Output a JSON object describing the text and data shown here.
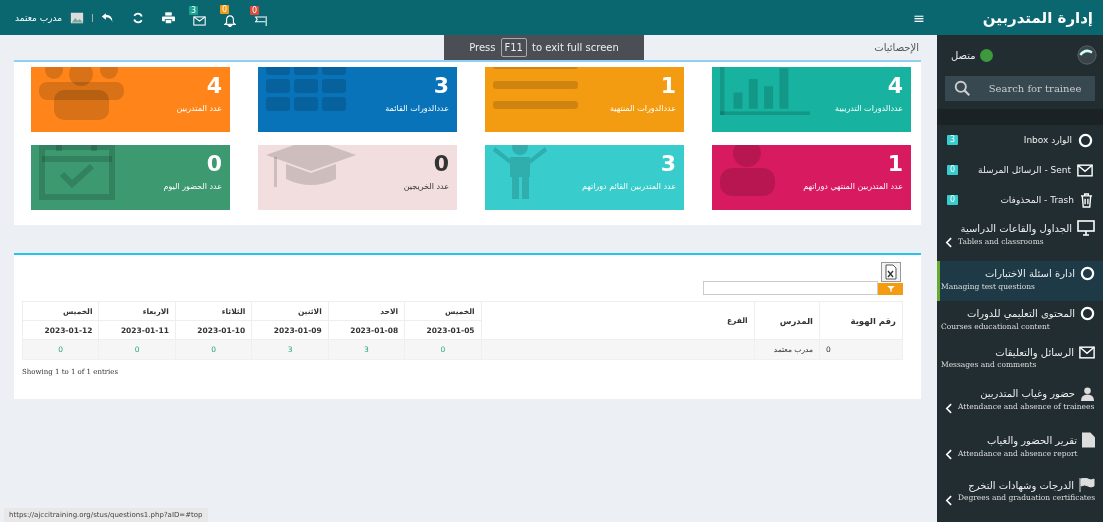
{
  "sidebar": {
    "title": "إدارة المتدربين",
    "user_status": "متصل",
    "search": {
      "placeholder": "Search for trainee"
    },
    "items": [
      {
        "kind": "mail",
        "label": "الوارد Inbox",
        "badge": "3",
        "selected": false
      },
      {
        "kind": "mail",
        "label": "Sent - الرسائل المرسلة",
        "badge": "0",
        "selected": false
      },
      {
        "kind": "mail",
        "label": "Trash - المحذوفات",
        "badge": "0",
        "selected": false
      },
      {
        "kind": "section",
        "label": "الجداول والقاعات الدراسية",
        "sublabel": "Tables and classrooms",
        "expandable": true,
        "selected": false
      },
      {
        "kind": "section",
        "label": "ادارة اسئلة الاختبارات",
        "sublabel": "Managing test questions",
        "expandable": false,
        "selected": true
      },
      {
        "kind": "section",
        "label": "المحتوى التعليمي للدورات",
        "sublabel": "Courses educational content",
        "expandable": false,
        "selected": false
      },
      {
        "kind": "section",
        "label": "الرسائل والتعليقات",
        "sublabel": "Messages and comments",
        "expandable": false,
        "selected": false
      },
      {
        "kind": "section",
        "label": "حضور وغياب المتدربين",
        "sublabel": "Attendance and absence of trainees",
        "expandable": true,
        "selected": false
      },
      {
        "kind": "section",
        "label": "تقرير الحضور والغياب",
        "sublabel": "Attendance and absence report",
        "expandable": true,
        "selected": false
      },
      {
        "kind": "section",
        "label": "الدرجات وشهادات التخرج",
        "sublabel": "Degrees and graduation certificates",
        "expandable": true,
        "selected": false
      }
    ]
  },
  "topbar": {
    "menu_glyph": "≡",
    "user_name": "مدرب معتمد",
    "notifications": [
      {
        "badge": "0",
        "color": "#dd4b39"
      },
      {
        "badge": "0",
        "color": "#f39c12"
      },
      {
        "badge": "3",
        "color": "#1aa38f"
      }
    ]
  },
  "fullscreen_hint": {
    "before": "Press",
    "key": "F11",
    "after": "to exit full screen"
  },
  "breadcrumb": "الإحصائيات",
  "stats": [
    {
      "value": "4",
      "label": "عددالدورات التدريبية",
      "color": "#17b3a0"
    },
    {
      "value": "1",
      "label": "عددالدورات المنتهية",
      "color": "#f39c12"
    },
    {
      "value": "3",
      "label": "عددالدورات القائمة",
      "color": "#0873b9"
    },
    {
      "value": "4",
      "label": "عدد المتدربين",
      "color": "#ff851b"
    },
    {
      "value": "1",
      "label": "عدد المتدربين المنتهي دوراتهم",
      "color": "#d81b60"
    },
    {
      "value": "3",
      "label": "عدد المتدربين القائم دوراتهم",
      "color": "#39cccc"
    },
    {
      "value": "0",
      "label": "عدد الخريجين",
      "color": "#f2dede"
    },
    {
      "value": "0",
      "label": "عدد الحضور اليوم",
      "color": "#3d9970"
    }
  ],
  "table": {
    "columns": [
      "رقم الهوية",
      "المدرس",
      "الفرع"
    ],
    "days": [
      {
        "day": "الخميس",
        "date": "2023-01-05"
      },
      {
        "day": "الاحد",
        "date": "2023-01-08"
      },
      {
        "day": "الاثنين",
        "date": "2023-01-09"
      },
      {
        "day": "الثلاثاء",
        "date": "2023-01-10"
      },
      {
        "day": "الاربعاء",
        "date": "2023-01-11"
      },
      {
        "day": "الخميس",
        "date": "2023-01-12"
      }
    ],
    "rows": [
      {
        "id": "0",
        "teacher": "مدرب معتمد",
        "counts": [
          "0",
          "3",
          "3",
          "0",
          "0",
          "0"
        ]
      }
    ],
    "info": "Showing 1 to 1 of 1 entries"
  },
  "status_url": "https://ajccitraining.org/stus/questions1.php?aID=#top"
}
